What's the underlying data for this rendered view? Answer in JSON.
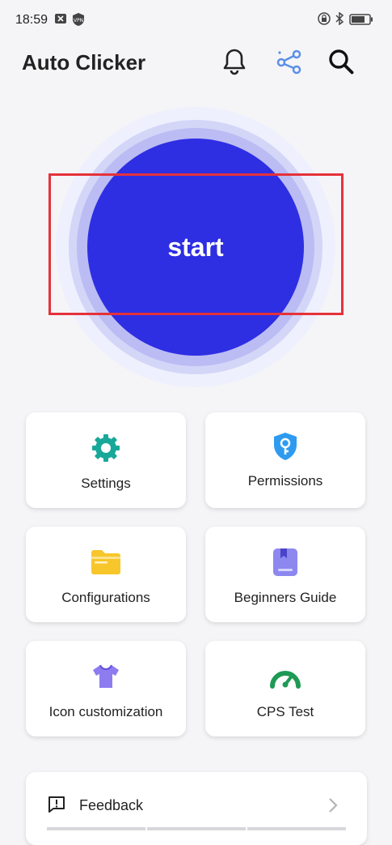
{
  "status": {
    "time": "18:59",
    "vpn": "VPN"
  },
  "app": {
    "title": "Auto Clicker"
  },
  "start": {
    "label": "start"
  },
  "cards": [
    {
      "label": "Settings",
      "icon": "gear-icon"
    },
    {
      "label": "Permissions",
      "icon": "shield-key-icon"
    },
    {
      "label": "Configurations",
      "icon": "folder-icon"
    },
    {
      "label": "Beginners Guide",
      "icon": "book-icon"
    },
    {
      "label": "Icon customization",
      "icon": "tshirt-icon"
    },
    {
      "label": "CPS Test",
      "icon": "speedometer-icon"
    }
  ],
  "feedback": {
    "label": "Feedback"
  },
  "colors": {
    "primary": "#2e2ee3",
    "highlight": "#e5323a",
    "teal": "#18a89a",
    "blue": "#2e9bf0",
    "yellow": "#f7c62b",
    "purple": "#8c88f0",
    "green": "#1e9a55"
  }
}
